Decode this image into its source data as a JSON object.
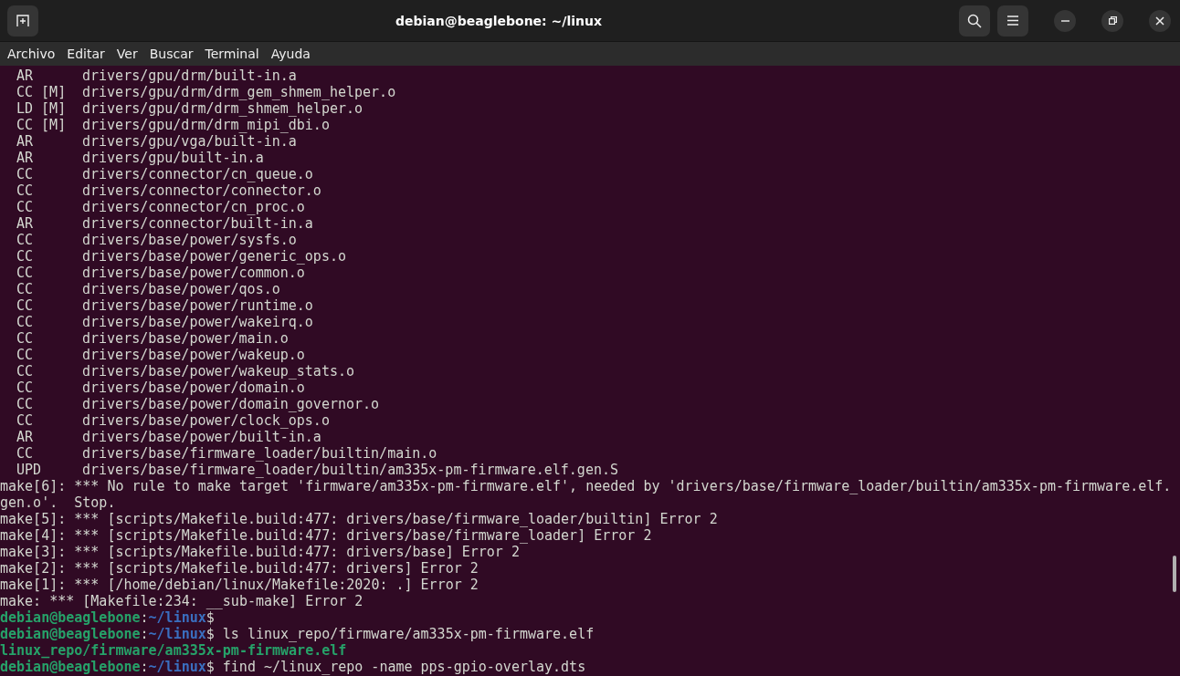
{
  "window": {
    "title": "debian@beaglebone: ~/linux"
  },
  "menu": [
    "Archivo",
    "Editar",
    "Ver",
    "Buscar",
    "Terminal",
    "Ayuda"
  ],
  "terminal": {
    "lines": [
      {
        "kind": "build",
        "tag": "AR",
        "path": "drivers/gpu/drm/built-in.a"
      },
      {
        "kind": "build",
        "tag": "CC [M]",
        "path": "drivers/gpu/drm/drm_gem_shmem_helper.o"
      },
      {
        "kind": "build",
        "tag": "LD [M]",
        "path": "drivers/gpu/drm/drm_shmem_helper.o"
      },
      {
        "kind": "build",
        "tag": "CC [M]",
        "path": "drivers/gpu/drm/drm_mipi_dbi.o"
      },
      {
        "kind": "build",
        "tag": "AR",
        "path": "drivers/gpu/vga/built-in.a"
      },
      {
        "kind": "build",
        "tag": "AR",
        "path": "drivers/gpu/built-in.a"
      },
      {
        "kind": "build",
        "tag": "CC",
        "path": "drivers/connector/cn_queue.o"
      },
      {
        "kind": "build",
        "tag": "CC",
        "path": "drivers/connector/connector.o"
      },
      {
        "kind": "build",
        "tag": "CC",
        "path": "drivers/connector/cn_proc.o"
      },
      {
        "kind": "build",
        "tag": "AR",
        "path": "drivers/connector/built-in.a"
      },
      {
        "kind": "build",
        "tag": "CC",
        "path": "drivers/base/power/sysfs.o"
      },
      {
        "kind": "build",
        "tag": "CC",
        "path": "drivers/base/power/generic_ops.o"
      },
      {
        "kind": "build",
        "tag": "CC",
        "path": "drivers/base/power/common.o"
      },
      {
        "kind": "build",
        "tag": "CC",
        "path": "drivers/base/power/qos.o"
      },
      {
        "kind": "build",
        "tag": "CC",
        "path": "drivers/base/power/runtime.o"
      },
      {
        "kind": "build",
        "tag": "CC",
        "path": "drivers/base/power/wakeirq.o"
      },
      {
        "kind": "build",
        "tag": "CC",
        "path": "drivers/base/power/main.o"
      },
      {
        "kind": "build",
        "tag": "CC",
        "path": "drivers/base/power/wakeup.o"
      },
      {
        "kind": "build",
        "tag": "CC",
        "path": "drivers/base/power/wakeup_stats.o"
      },
      {
        "kind": "build",
        "tag": "CC",
        "path": "drivers/base/power/domain.o"
      },
      {
        "kind": "build",
        "tag": "CC",
        "path": "drivers/base/power/domain_governor.o"
      },
      {
        "kind": "build",
        "tag": "CC",
        "path": "drivers/base/power/clock_ops.o"
      },
      {
        "kind": "build",
        "tag": "AR",
        "path": "drivers/base/power/built-in.a"
      },
      {
        "kind": "build",
        "tag": "CC",
        "path": "drivers/base/firmware_loader/builtin/main.o"
      },
      {
        "kind": "build",
        "tag": "UPD",
        "path": "drivers/base/firmware_loader/builtin/am335x-pm-firmware.elf.gen.S"
      },
      {
        "kind": "output",
        "text": "make[6]: *** No rule to make target 'firmware/am335x-pm-firmware.elf', needed by 'drivers/base/firmware_loader/builtin/am335x-pm-firmware.elf."
      },
      {
        "kind": "output",
        "text": "gen.o'.  Stop."
      },
      {
        "kind": "output",
        "text": "make[5]: *** [scripts/Makefile.build:477: drivers/base/firmware_loader/builtin] Error 2"
      },
      {
        "kind": "output",
        "text": "make[4]: *** [scripts/Makefile.build:477: drivers/base/firmware_loader] Error 2"
      },
      {
        "kind": "output",
        "text": "make[3]: *** [scripts/Makefile.build:477: drivers/base] Error 2"
      },
      {
        "kind": "output",
        "text": "make[2]: *** [scripts/Makefile.build:477: drivers] Error 2"
      },
      {
        "kind": "output",
        "text": "make[1]: *** [/home/debian/linux/Makefile:2020: .] Error 2"
      },
      {
        "kind": "output",
        "text": "make: *** [Makefile:234: __sub-make] Error 2"
      },
      {
        "kind": "prompt",
        "user": "debian@beaglebone",
        "sep": ":",
        "path": "~/linux",
        "symbol": "$"
      },
      {
        "kind": "prompt",
        "user": "debian@beaglebone",
        "sep": ":",
        "path": "~/linux",
        "symbol": "$",
        "command": "ls linux_repo/firmware/am335x-pm-firmware.elf"
      },
      {
        "kind": "file",
        "text": "linux_repo/firmware/am335x-pm-firmware.elf"
      },
      {
        "kind": "prompt",
        "user": "debian@beaglebone",
        "sep": ":",
        "path": "~/linux",
        "symbol": "$",
        "command": "find ~/linux_repo -name pps-gpio-overlay.dts"
      }
    ]
  }
}
